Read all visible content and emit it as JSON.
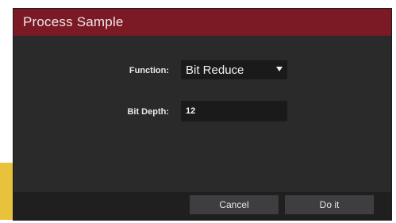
{
  "dialog": {
    "title": "Process Sample"
  },
  "form": {
    "function_label": "Function:",
    "function_value": "Bit Reduce",
    "bitdepth_label": "Bit Depth:",
    "bitdepth_value": "12"
  },
  "buttons": {
    "cancel_label": "Cancel",
    "doit_label": "Do it"
  },
  "colors": {
    "titlebar": "#7b1a24",
    "dialog_bg": "#2a2a2b",
    "field_bg": "#1a1a1b",
    "button_bg": "#3e3e40",
    "accent_strip": "#e8c23a"
  },
  "icons": {
    "dropdown": "chevron-down-icon"
  }
}
